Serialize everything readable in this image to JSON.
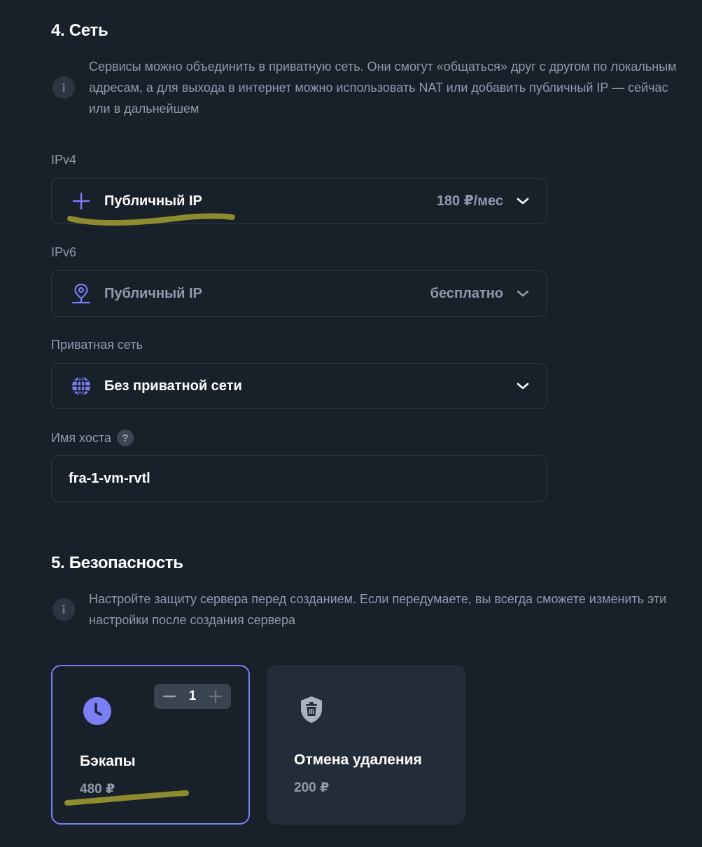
{
  "network": {
    "title": "4. Сеть",
    "info": "Сервисы можно объединить в приватную сеть. Они смогут «общаться» друг с другом по локальным адресам, а для выхода в интернет можно использовать NAT или добавить публичный IP — сейчас или в дальнейшем",
    "ipv4": {
      "label": "IPv4",
      "value": "Публичный IP",
      "price": "180 ₽/мес",
      "icon": "plus-icon"
    },
    "ipv6": {
      "label": "IPv6",
      "value": "Публичный IP",
      "price": "бесплатно",
      "icon": "location-pin-icon"
    },
    "private_network": {
      "label": "Приватная сеть",
      "value": "Без приватной сети",
      "icon": "globe-icon"
    },
    "hostname": {
      "label": "Имя хоста",
      "help": "?",
      "value": "fra-1-vm-rvtl"
    }
  },
  "security": {
    "title": "5. Безопасность",
    "info": "Настройте защиту сервера перед созданием. Если передумаете, вы всегда сможете изменить эти настройки после создания сервера",
    "cards": [
      {
        "title": "Бэкапы",
        "price": "480 ₽",
        "count": "1",
        "selected": true,
        "icon": "clock-icon"
      },
      {
        "title": "Отмена удаления",
        "price": "200 ₽",
        "selected": false,
        "icon": "shield-trash-icon"
      }
    ]
  },
  "colors": {
    "background": "#18202a",
    "accent": "#7b7ef5",
    "muted_text": "#8f9bab",
    "card_bg": "#232d3a",
    "annotation_marker": "#8f8a2e"
  }
}
